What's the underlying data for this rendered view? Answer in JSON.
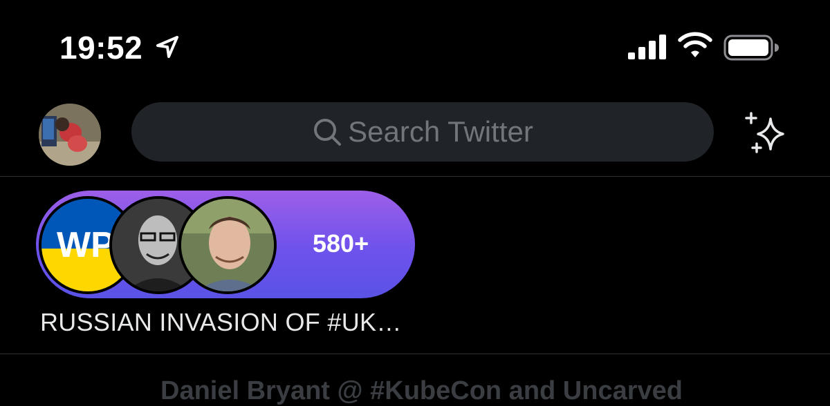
{
  "status_bar": {
    "time": "19:52",
    "icons": [
      "location-arrow-icon",
      "cellular-signal-icon",
      "wifi-icon",
      "battery-icon"
    ]
  },
  "top_bar": {
    "avatar_icon": "profile-avatar",
    "search": {
      "placeholder": "Search Twitter",
      "icon": "search-icon"
    },
    "sparkle_icon": "sparkle-icon"
  },
  "fleet": {
    "count": "580+",
    "label": "RUSSIAN INVASION OF #UK…",
    "avatar_badge_text": "WP",
    "colors": {
      "gradient_top": "#9d5fe8",
      "gradient_bottom": "#5a52e6",
      "flag_blue": "#0057b7",
      "flag_yellow": "#ffd700"
    }
  },
  "timeline": {
    "next_author": "Daniel Bryant @ #KubeCon and Uncarved"
  },
  "colors": {
    "background": "#000000",
    "search_bg": "#202327",
    "placeholder": "#71767b",
    "divider": "#2f3336"
  }
}
